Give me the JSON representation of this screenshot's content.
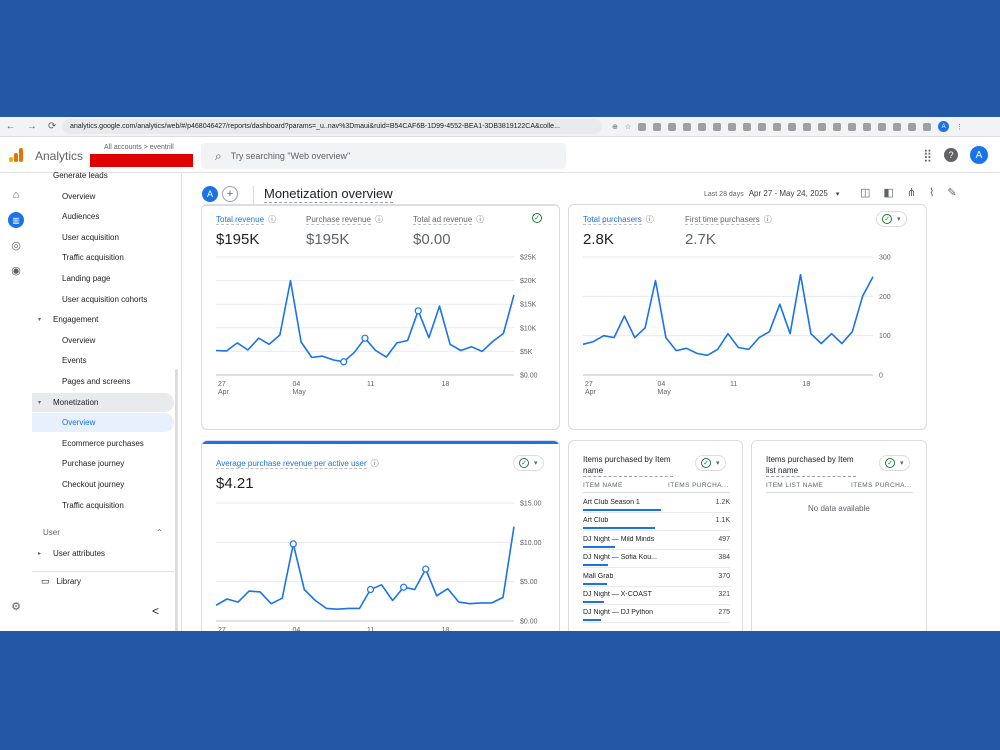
{
  "browser": {
    "url": "analytics.google.com/analytics/web/#/p468046427/reports/dashboard?params=_u..nav%3Dmaui&ruid=B54CAF6B-1D99-4552-BEA1-3DB3819122CA&colle...",
    "profile_initial": "A"
  },
  "appbar": {
    "app_name": "Analytics",
    "account_path": "All accounts > eventrill",
    "search_placeholder": "Try searching \"Web overview\"",
    "avatar_initial": "A"
  },
  "sidebar": {
    "items": [
      {
        "label": "Generate leads",
        "level": 1
      },
      {
        "label": "Overview",
        "level": 2
      },
      {
        "label": "Audiences",
        "level": 2
      },
      {
        "label": "User acquisition",
        "level": 2
      },
      {
        "label": "Traffic acquisition",
        "level": 2
      },
      {
        "label": "Landing page",
        "level": 2
      },
      {
        "label": "User acquisition cohorts",
        "level": 2
      },
      {
        "label": "Engagement",
        "level": 1
      },
      {
        "label": "Overview",
        "level": 2
      },
      {
        "label": "Events",
        "level": 2
      },
      {
        "label": "Pages and screens",
        "level": 2
      },
      {
        "label": "Monetization",
        "level": 1
      },
      {
        "label": "Overview",
        "level": 2
      },
      {
        "label": "Ecommerce purchases",
        "level": 2
      },
      {
        "label": "Purchase journey",
        "level": 2
      },
      {
        "label": "Checkout journey",
        "level": 2
      },
      {
        "label": "Traffic acquisition",
        "level": 2
      }
    ],
    "user_section": "User",
    "user_attributes": "User attributes",
    "library": "Library",
    "collapse": "<"
  },
  "header": {
    "comparison_chip": "A",
    "add_comparison": "+",
    "title": "Monetization overview",
    "date_label": "Last 28 days",
    "date_range": "Apr 27 - May 24, 2025"
  },
  "revenue_card": {
    "metrics": [
      {
        "label": "Total revenue",
        "value": "$195K"
      },
      {
        "label": "Purchase revenue",
        "value": "$195K"
      },
      {
        "label": "Total ad revenue",
        "value": "$0.00"
      }
    ]
  },
  "purchasers_card": {
    "metrics": [
      {
        "label": "Total purchasers",
        "value": "2.8K"
      },
      {
        "label": "First time purchasers",
        "value": "2.7K"
      }
    ]
  },
  "arpu_card": {
    "metric": {
      "label": "Average purchase revenue per active user",
      "value": "$4.21"
    }
  },
  "items_card": {
    "title": "Items purchased by Item name",
    "col_name": "ITEM NAME",
    "col_value": "ITEMS PURCHA...",
    "rows": [
      {
        "name": "Art Club Season 1",
        "value": "1.2K",
        "num": 1200
      },
      {
        "name": "Art Club",
        "value": "1.1K",
        "num": 1100
      },
      {
        "name": "DJ Night — Mild Minds",
        "value": "497",
        "num": 497
      },
      {
        "name": "DJ Night — Sofia Kou...",
        "value": "384",
        "num": 384
      },
      {
        "name": "Mall Grab",
        "value": "370",
        "num": 370
      },
      {
        "name": "DJ Night — X-COAST",
        "value": "321",
        "num": 321
      },
      {
        "name": "DJ Night — DJ Python",
        "value": "275",
        "num": 275
      }
    ]
  },
  "list_card": {
    "title": "Items purchased by Item list name",
    "col_name": "ITEM LIST NAME",
    "col_value": "ITEMS PURCHA...",
    "empty": "No data available"
  },
  "chart_data": [
    {
      "type": "line",
      "title": "Total revenue",
      "x_ticks": [
        {
          "i": 0,
          "label": "27",
          "sub": "Apr"
        },
        {
          "i": 7,
          "label": "04",
          "sub": "May"
        },
        {
          "i": 14,
          "label": "11",
          "sub": ""
        },
        {
          "i": 21,
          "label": "18",
          "sub": ""
        }
      ],
      "y_ticks": [
        "$0.00",
        "$5K",
        "$10K",
        "$15K",
        "$20K",
        "$25K"
      ],
      "ylim": [
        0,
        25000
      ],
      "values": [
        5200,
        5100,
        6800,
        5300,
        7800,
        6500,
        8500,
        20000,
        7000,
        3700,
        4000,
        3200,
        2800,
        4800,
        7800,
        5200,
        3800,
        6800,
        7300,
        13600,
        7900,
        14600,
        6500,
        5200,
        6000,
        5000,
        7100,
        8800,
        17000
      ],
      "markers": [
        12,
        14,
        19
      ]
    },
    {
      "type": "line",
      "title": "Total purchasers",
      "x_ticks": [
        {
          "i": 0,
          "label": "27",
          "sub": "Apr"
        },
        {
          "i": 7,
          "label": "04",
          "sub": "May"
        },
        {
          "i": 14,
          "label": "11",
          "sub": ""
        },
        {
          "i": 21,
          "label": "18",
          "sub": ""
        }
      ],
      "y_ticks": [
        "0",
        "100",
        "200",
        "300"
      ],
      "ylim": [
        0,
        300
      ],
      "values": [
        78,
        85,
        100,
        95,
        150,
        95,
        120,
        240,
        95,
        62,
        68,
        55,
        50,
        65,
        105,
        70,
        65,
        95,
        110,
        180,
        105,
        255,
        105,
        80,
        105,
        80,
        110,
        200,
        250
      ],
      "markers": []
    },
    {
      "type": "line",
      "title": "Average purchase revenue per active user",
      "x_ticks": [
        {
          "i": 0,
          "label": "27",
          "sub": ""
        },
        {
          "i": 7,
          "label": "04",
          "sub": ""
        },
        {
          "i": 14,
          "label": "11",
          "sub": ""
        },
        {
          "i": 21,
          "label": "18",
          "sub": ""
        }
      ],
      "y_ticks": [
        "$0.00",
        "$5.00",
        "$10.00",
        "$15.00"
      ],
      "ylim": [
        0,
        15
      ],
      "values": [
        2.0,
        2.8,
        2.4,
        3.8,
        3.7,
        2.2,
        2.9,
        9.8,
        4.0,
        2.6,
        1.6,
        1.5,
        1.6,
        1.6,
        4.0,
        4.6,
        2.6,
        4.3,
        4.0,
        6.6,
        3.2,
        4.1,
        2.4,
        2.2,
        2.3,
        2.3,
        3.0,
        12.0
      ],
      "markers": [
        7,
        14,
        17,
        19
      ]
    }
  ],
  "colors": {
    "accent": "#1a73e8",
    "check": "#188038",
    "redaction": "#e00000"
  }
}
